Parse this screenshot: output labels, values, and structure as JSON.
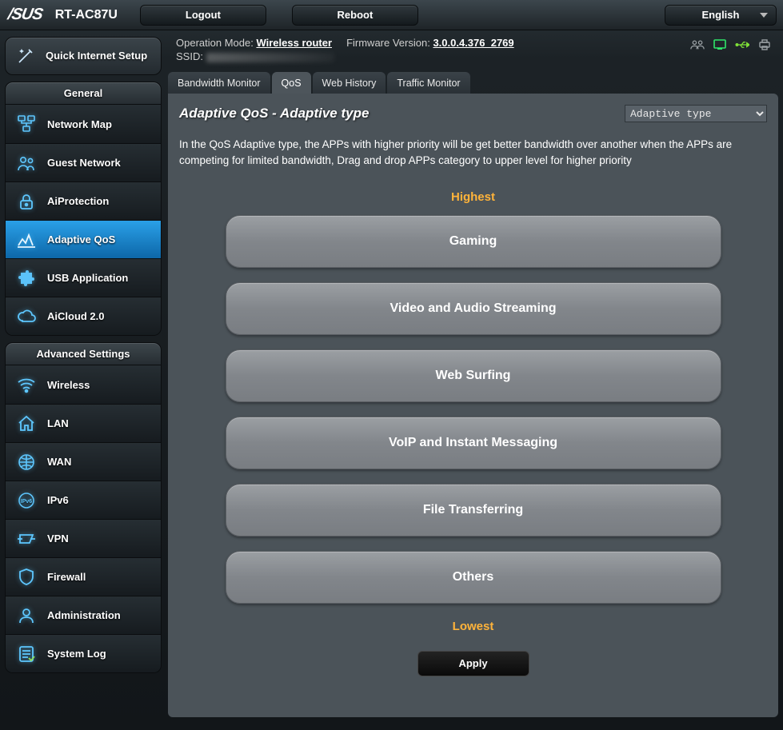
{
  "header": {
    "brand": "/SUS",
    "model": "RT-AC87U",
    "logout": "Logout",
    "reboot": "Reboot",
    "language": "English"
  },
  "status": {
    "op_mode_label": "Operation Mode:",
    "op_mode_value": "Wireless router",
    "fw_label": "Firmware Version:",
    "fw_value": "3.0.0.4.376_2769",
    "ssid_label": "SSID:"
  },
  "quick_setup": "Quick Internet Setup",
  "sidebar": {
    "general_title": "General",
    "general": [
      {
        "label": "Network Map"
      },
      {
        "label": "Guest Network"
      },
      {
        "label": "AiProtection"
      },
      {
        "label": "Adaptive QoS"
      },
      {
        "label": "USB Application"
      },
      {
        "label": "AiCloud 2.0"
      }
    ],
    "advanced_title": "Advanced Settings",
    "advanced": [
      {
        "label": "Wireless"
      },
      {
        "label": "LAN"
      },
      {
        "label": "WAN"
      },
      {
        "label": "IPv6"
      },
      {
        "label": "VPN"
      },
      {
        "label": "Firewall"
      },
      {
        "label": "Administration"
      },
      {
        "label": "System Log"
      }
    ]
  },
  "tabs": [
    "Bandwidth Monitor",
    "QoS",
    "Web History",
    "Traffic Monitor"
  ],
  "panel": {
    "title": "Adaptive QoS - Adaptive type",
    "select_value": "Adaptive type",
    "description": "In the QoS Adaptive type, the APPs with higher priority will be get better bandwidth over another when the APPs are competing for limited bandwidth, Drag and drop APPs category to upper level for higher priority",
    "highest": "Highest",
    "lowest": "Lowest",
    "categories": [
      "Gaming",
      "Video and Audio Streaming",
      "Web Surfing",
      "VoIP and Instant Messaging",
      "File Transferring",
      "Others"
    ],
    "apply": "Apply"
  }
}
